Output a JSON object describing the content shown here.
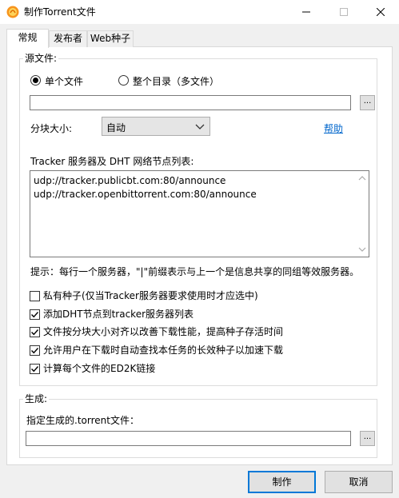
{
  "window": {
    "title": "制作Torrent文件",
    "icon": "orange-torrent-app-icon"
  },
  "tabs": [
    {
      "label": "常规",
      "active": true
    },
    {
      "label": "发布者",
      "active": false
    },
    {
      "label": "Web种子",
      "active": false
    }
  ],
  "source": {
    "group_label": "源文件:",
    "radio_single_label": "单个文件",
    "radio_dir_label": "整个目录（多文件）",
    "selected": "single",
    "path_value": "",
    "browse_label": "...",
    "piece_size_label": "分块大小:",
    "piece_size_value": "自动",
    "help_link": "帮助",
    "tracker_label": "Tracker 服务器及 DHT 网络节点列表:",
    "trackers": [
      "udp://tracker.publicbt.com:80/announce",
      "udp://tracker.openbittorrent.com:80/announce"
    ],
    "hint": "提示：每行一个服务器，\"|\"前缀表示与上一个是信息共享的同组等效服务器。",
    "options": [
      {
        "label": "私有种子(仅当Tracker服务器要求使用时才应选中)",
        "checked": false
      },
      {
        "label": "添加DHT节点到tracker服务器列表",
        "checked": true
      },
      {
        "label": "文件按分块大小对齐以改善下载性能，提高种子存活时间",
        "checked": true
      },
      {
        "label": "允许用户在下载时自动查找本任务的长效种子以加速下载",
        "checked": true
      },
      {
        "label": "计算每个文件的ED2K链接",
        "checked": true
      }
    ]
  },
  "output": {
    "group_label": "生成:",
    "file_label": "指定生成的.torrent文件：",
    "path_value": "",
    "browse_label": "..."
  },
  "buttons": {
    "create": "制作",
    "cancel": "取消"
  }
}
